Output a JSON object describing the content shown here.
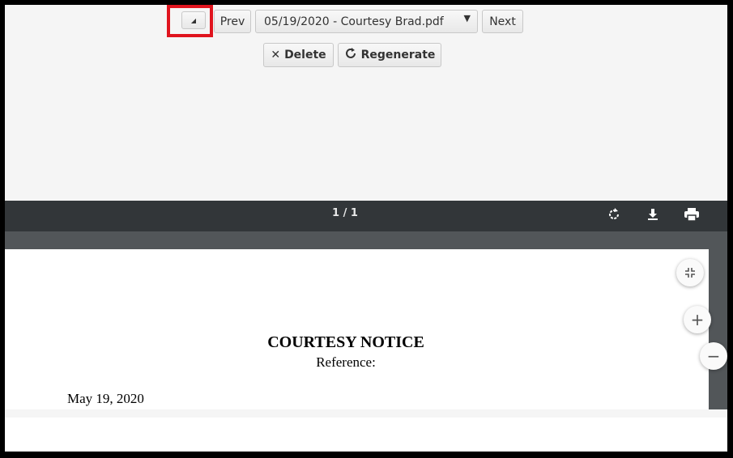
{
  "nav": {
    "collapse_glyph": "◢",
    "prev_label": "Prev",
    "file_name": "05/19/2020 - Courtesy Brad.pdf",
    "dropdown_glyph": "▼",
    "next_label": "Next"
  },
  "actions": {
    "delete_label": "Delete",
    "delete_icon": "✕",
    "regenerate_label": "Regenerate",
    "regenerate_icon": "⟳"
  },
  "viewer": {
    "page_count": "1 / 1",
    "icons": [
      "rotate-icon",
      "download-icon",
      "print-icon"
    ]
  },
  "document": {
    "title": "COURTESY NOTICE",
    "reference": "Reference:",
    "date": "May 19, 2020"
  },
  "zoom": {
    "zoom_in": "+",
    "zoom_out": "−"
  },
  "colors": {
    "highlight": "#e0141e",
    "toolbar": "#323639",
    "viewer_bg": "#525659"
  }
}
